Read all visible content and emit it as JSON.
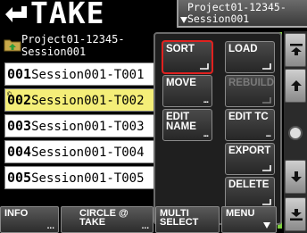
{
  "header": {
    "title": "TAKE",
    "project_line1": "Project01-12345-",
    "project_line2": "Session001"
  },
  "folder": {
    "line1": "Project01-12345-",
    "line2": "Session001"
  },
  "takes": [
    {
      "num": "001",
      "name": "Session001-T001",
      "selected": false
    },
    {
      "num": "002",
      "name": "Session001-T002",
      "selected": true
    },
    {
      "num": "003",
      "name": "Session001-T003",
      "selected": false
    },
    {
      "num": "004",
      "name": "Session001-T004",
      "selected": false
    },
    {
      "num": "005",
      "name": "Session001-T005",
      "selected": false
    }
  ],
  "popup": {
    "sort": "SORT",
    "load": "LOAD",
    "move": "MOVE",
    "rebuild": "REBUILD",
    "edit_name_1": "EDIT",
    "edit_name_2": "NAME",
    "edit_tc": "EDIT TC",
    "export": "EXPORT",
    "delete": "DELETE"
  },
  "bottom": {
    "info": "INFO",
    "circle_take_1": "CIRCLE @",
    "circle_take_2": "TAKE",
    "multi_select_1": "MULTI",
    "multi_select_2": "SELECT",
    "menu": "MENU"
  },
  "colors": {
    "selected_row": "#f4ee78",
    "highlight": "#e0211f",
    "scroll_green": "#7dcf3e"
  }
}
